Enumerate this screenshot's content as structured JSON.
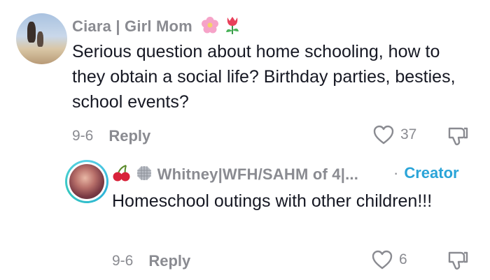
{
  "comment": {
    "username": "Ciara | Girl Mom",
    "emojis": [
      "flower-emoji",
      "tulip-emoji"
    ],
    "text": "Serious question about home schooling, how to they obtain a social life? Birthday parties, besties, school events?",
    "date": "9-6",
    "reply_label": "Reply",
    "like_count": "37"
  },
  "reply": {
    "emojis": [
      "cherries-emoji",
      "disco-ball-emoji"
    ],
    "username": "Whitney|WFH/SAHM of 4|...",
    "creator_label": "Creator",
    "text": "Homeschool outings with other children!!!",
    "date": "9-6",
    "reply_label": "Reply",
    "like_count": "6"
  },
  "colors": {
    "username": "#8a8b91",
    "text": "#161823",
    "creator": "#2aa4d8"
  }
}
